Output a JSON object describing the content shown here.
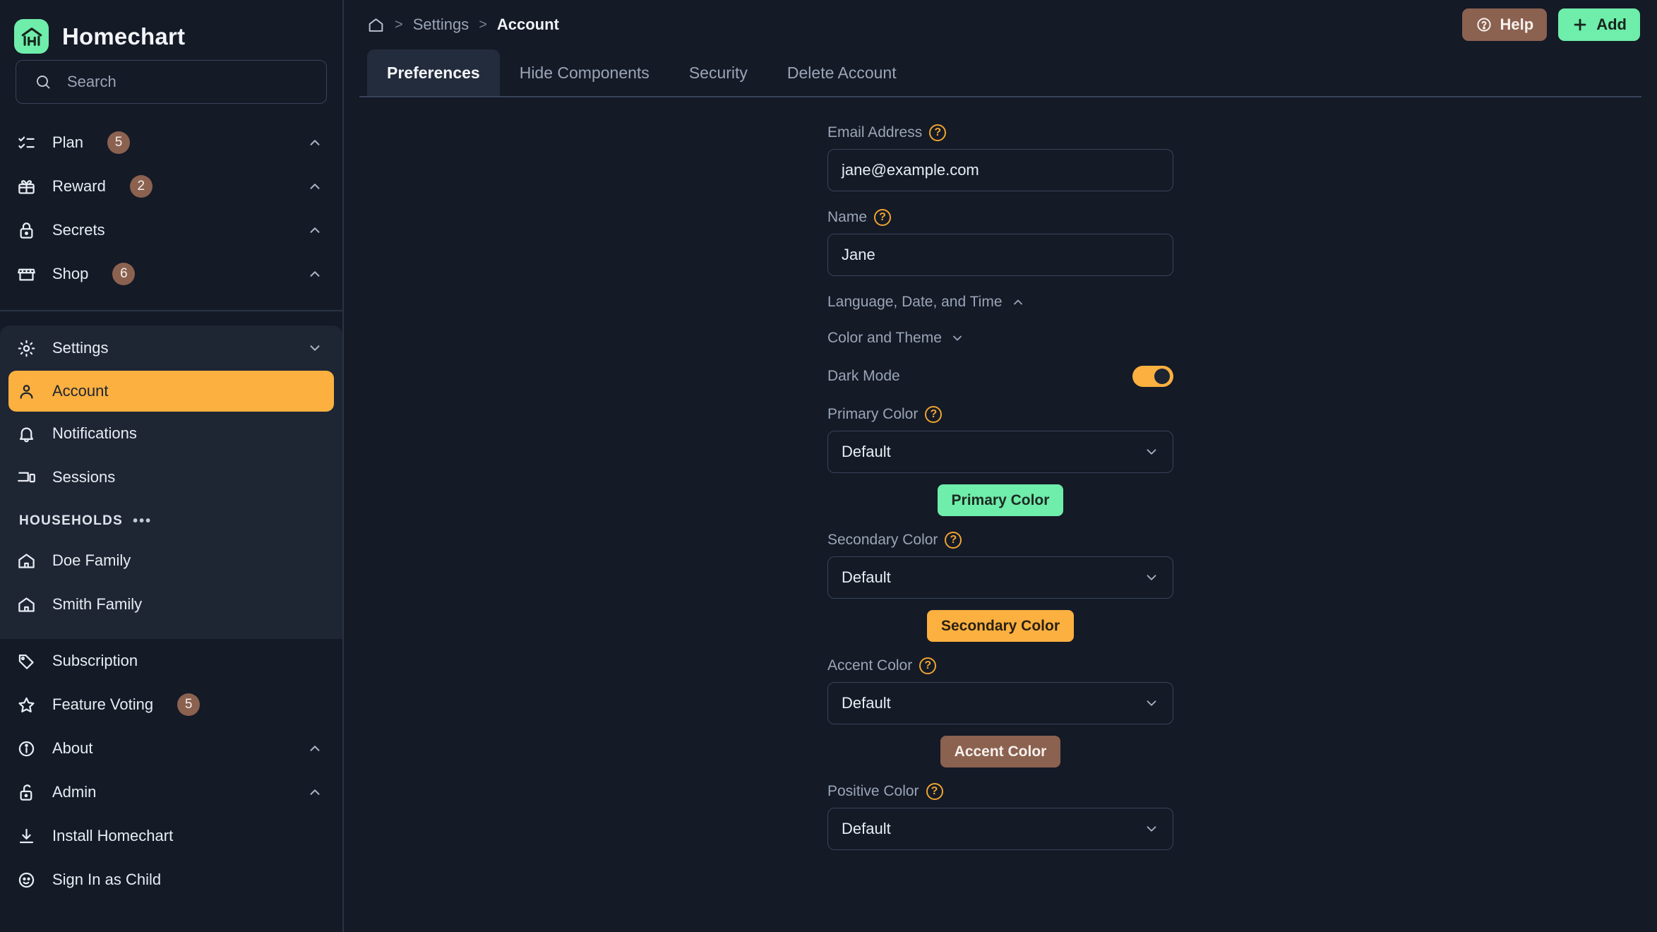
{
  "brand": {
    "title": "Homechart",
    "logo_icon": "homechart-logo-icon"
  },
  "search": {
    "placeholder": "Search",
    "icon": "search-icon"
  },
  "sidebar": {
    "top_items": [
      {
        "label": "Plan",
        "badge": "5",
        "icon": "checklist-icon",
        "chevron": "chevron-up-icon"
      },
      {
        "label": "Reward",
        "badge": "2",
        "icon": "gift-icon",
        "chevron": "chevron-up-icon"
      },
      {
        "label": "Secrets",
        "badge": "",
        "icon": "lock-icon",
        "chevron": "chevron-up-icon"
      },
      {
        "label": "Shop",
        "badge": "6",
        "icon": "store-icon",
        "chevron": "chevron-up-icon"
      }
    ],
    "settings": {
      "label": "Settings",
      "icon": "gear-icon",
      "chevron": "chevron-down-icon"
    },
    "settings_items": [
      {
        "label": "Account",
        "icon": "user-icon",
        "active": true
      },
      {
        "label": "Notifications",
        "icon": "bell-icon",
        "active": false
      },
      {
        "label": "Sessions",
        "icon": "devices-icon",
        "active": false
      }
    ],
    "households_header": {
      "label": "HOUSEHOLDS",
      "menu_icon": "ellipsis-icon"
    },
    "households": [
      {
        "label": "Doe Family",
        "icon": "house-icon"
      },
      {
        "label": "Smith Family",
        "icon": "house-icon"
      }
    ],
    "bottom_items": [
      {
        "label": "Subscription",
        "badge": "",
        "icon": "tag-icon",
        "chevron": ""
      },
      {
        "label": "Feature Voting",
        "badge": "5",
        "icon": "star-icon",
        "chevron": ""
      },
      {
        "label": "About",
        "badge": "",
        "icon": "info-icon",
        "chevron": "chevron-up-icon"
      },
      {
        "label": "Admin",
        "badge": "",
        "icon": "unlock-icon",
        "chevron": "chevron-up-icon"
      },
      {
        "label": "Install Homechart",
        "badge": "",
        "icon": "download-icon",
        "chevron": ""
      },
      {
        "label": "Sign In as Child",
        "badge": "",
        "icon": "child-face-icon",
        "chevron": ""
      }
    ]
  },
  "topbar": {
    "breadcrumb": {
      "home_icon": "home-icon",
      "sep": ">",
      "parent": "Settings",
      "current": "Account"
    },
    "help_button": {
      "label": "Help",
      "icon": "question-circle-icon"
    },
    "add_button": {
      "label": "Add",
      "icon": "plus-icon"
    }
  },
  "tabs": [
    {
      "label": "Preferences",
      "active": true
    },
    {
      "label": "Hide Components",
      "active": false
    },
    {
      "label": "Security",
      "active": false
    },
    {
      "label": "Delete Account",
      "active": false
    }
  ],
  "form": {
    "email": {
      "label": "Email Address",
      "value": "jane@example.com",
      "help": "?"
    },
    "name": {
      "label": "Name",
      "value": "Jane",
      "help": "?"
    },
    "language_section": {
      "label": "Language, Date, and Time",
      "chevron": "chevron-up-icon"
    },
    "color_section": {
      "label": "Color and Theme",
      "chevron": "chevron-down-icon"
    },
    "dark_mode": {
      "label": "Dark Mode",
      "on": true
    },
    "primary": {
      "label": "Primary Color",
      "value": "Default",
      "help": "?",
      "swatch_label": "Primary Color",
      "swatch_bg": "#6fedaa",
      "swatch_fg": "#1d2a22"
    },
    "secondary": {
      "label": "Secondary Color",
      "value": "Default",
      "help": "?",
      "swatch_label": "Secondary Color",
      "swatch_bg": "#fbb040",
      "swatch_fg": "#2b2112"
    },
    "accent": {
      "label": "Accent Color",
      "value": "Default",
      "help": "?",
      "swatch_label": "Accent Color",
      "swatch_bg": "#8b6150",
      "swatch_fg": "#f6f1ee"
    },
    "positive": {
      "label": "Positive Color",
      "value": "Default",
      "help": "?"
    }
  },
  "colors": {
    "background": "#141a26",
    "panel": "#1e2634",
    "accent_orange": "#fbb040",
    "accent_green": "#6fedaa",
    "accent_brown": "#8b6150",
    "border": "#39445a",
    "muted_text": "#9aa5b7"
  }
}
